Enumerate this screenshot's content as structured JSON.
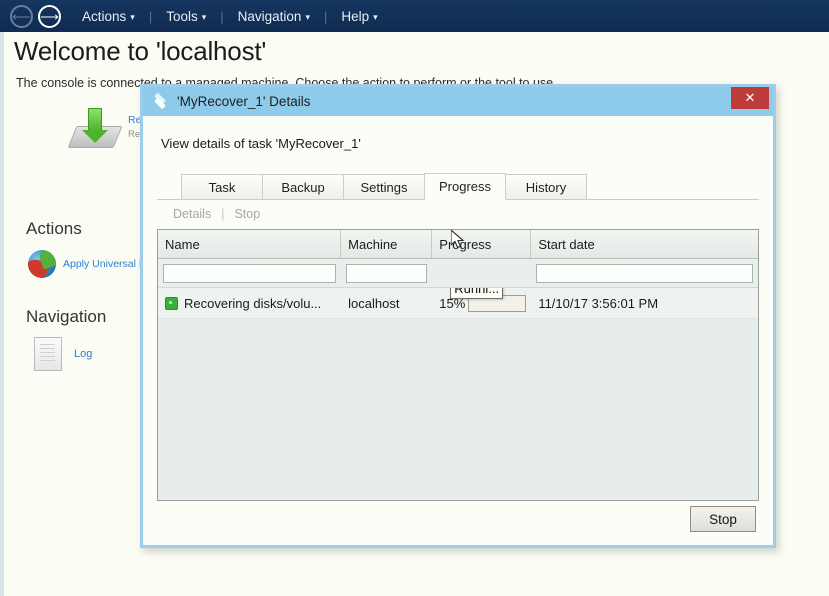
{
  "topbar": {
    "back_icon": "arrow-left-circle-icon",
    "forward_icon": "arrow-right-circle-icon",
    "menus": [
      {
        "label": "Actions",
        "caret": "▾"
      },
      {
        "label": "Tools",
        "caret": "▾"
      },
      {
        "label": "Navigation",
        "caret": "▾"
      },
      {
        "label": "Help",
        "caret": "▾"
      }
    ],
    "separator": "|"
  },
  "page": {
    "title": "Welcome to 'localhost'",
    "subtitle": "The console is connected to a managed machine. Choose the action to perform or the tool to use.",
    "recover": {
      "icon": "recover-disk-icon",
      "link": "Recover",
      "description": "Recover"
    },
    "sections": {
      "actions_heading": "Actions",
      "navigation_heading": "Navigation"
    },
    "actions_items": [
      {
        "icon": "globe-restore-icon",
        "label": "Apply Universal Restore"
      }
    ],
    "navigation_items": [
      {
        "icon": "log-document-icon",
        "label": "Log"
      }
    ]
  },
  "dialog": {
    "icon": "layers-icon",
    "title": "'MyRecover_1' Details",
    "close_label": "✕",
    "heading": "View details of task 'MyRecover_1'",
    "tabs": [
      {
        "label": "Task",
        "active": false
      },
      {
        "label": "Backup",
        "active": false
      },
      {
        "label": "Settings",
        "active": false
      },
      {
        "label": "Progress",
        "active": true
      },
      {
        "label": "History",
        "active": false
      }
    ],
    "toolbar": {
      "details_label": "Details",
      "separator": "|",
      "stop_label": "Stop"
    },
    "table": {
      "columns": [
        "Name",
        "Machine",
        "Progress",
        "Start date"
      ],
      "filters": {
        "name": "",
        "machine": "",
        "start_date": ""
      },
      "filter_placeholder": "",
      "rows": [
        {
          "status_icon": "running-status-icon",
          "name": "Recovering disks/volu...",
          "machine": "localhost",
          "progress_pct": "15%",
          "progress_value": 15,
          "tooltip": "Runni...",
          "start_date": "11/10/17 3:56:01 PM"
        }
      ]
    },
    "footer": {
      "stop_button": "Stop"
    }
  },
  "colors": {
    "topbar": "#12315c",
    "dialog_border": "#9ccdea",
    "dialog_titlebar": "#8ecaea",
    "close_red": "#bd3b3b",
    "progress_green": "#3fb224",
    "link_blue": "#2f7fd0"
  }
}
